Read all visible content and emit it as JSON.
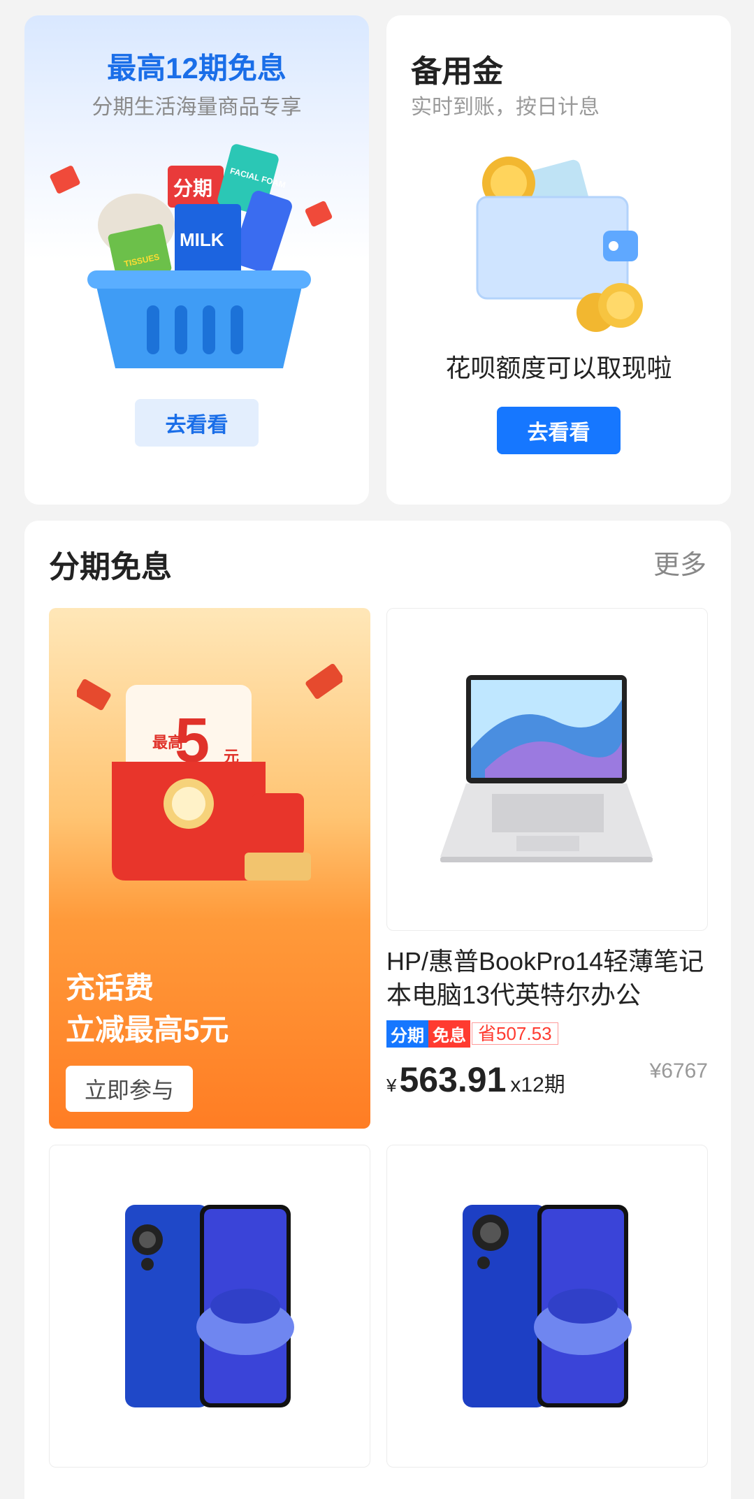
{
  "installment_card": {
    "title": "最高12期免息",
    "subtitle": "分期生活海量商品专享",
    "button": "去看看",
    "illus_labels": {
      "tag": "分期",
      "milk": "MILK",
      "tissues": "TISSUES",
      "foam": "FACIAL FOAM"
    }
  },
  "reserve_card": {
    "title": "备用金",
    "subtitle": "实时到账，按日计息",
    "description": "花呗额度可以取现啦",
    "button": "去看看"
  },
  "free_section": {
    "title": "分期免息",
    "more": "更多",
    "promo": {
      "line1": "充话费",
      "line2": "立减最高5元",
      "button": "立即参与",
      "badge_top": "最高",
      "badge_amount": "5",
      "badge_unit": "元"
    },
    "products": [
      {
        "name": "HP/惠普BookPro14轻薄笔记本电脑13代英特尔办公",
        "tag_a": "分期",
        "tag_b": "免息",
        "tag_c": "省507.53",
        "currency": "¥",
        "price": "563.91",
        "period": "x12期",
        "original": "¥6767"
      },
      {
        "name": ""
      },
      {
        "name": ""
      }
    ]
  },
  "colors": {
    "accent": "#1677ff",
    "red": "#ff3b30",
    "orange": "#ff7d24"
  }
}
